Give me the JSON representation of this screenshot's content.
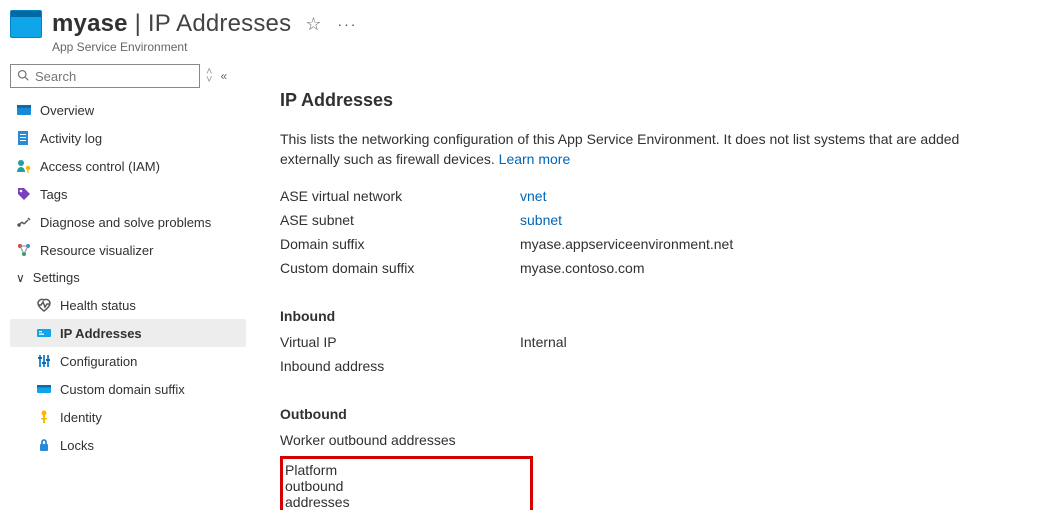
{
  "header": {
    "resource_name": "myase",
    "page_name": "IP Addresses",
    "resource_type": "App Service Environment",
    "star_tooltip": "Add to favorites",
    "more_tooltip": "More commands"
  },
  "sidebar": {
    "search_placeholder": "Search",
    "items": [
      {
        "label": "Overview"
      },
      {
        "label": "Activity log"
      },
      {
        "label": "Access control (IAM)"
      },
      {
        "label": "Tags"
      },
      {
        "label": "Diagnose and solve problems"
      },
      {
        "label": "Resource visualizer"
      }
    ],
    "settings_label": "Settings",
    "settings": [
      {
        "label": "Health status"
      },
      {
        "label": "IP Addresses"
      },
      {
        "label": "Configuration"
      },
      {
        "label": "Custom domain suffix"
      },
      {
        "label": "Identity"
      },
      {
        "label": "Locks"
      }
    ]
  },
  "main": {
    "title": "IP Addresses",
    "description": "This lists the networking configuration of this App Service Environment. It does not list systems that are added externally such as firewall devices.",
    "learn_more": "Learn more",
    "kv": {
      "ase_vnet_label": "ASE virtual network",
      "ase_vnet_value": "vnet",
      "ase_subnet_label": "ASE subnet",
      "ase_subnet_value": "subnet",
      "domain_suffix_label": "Domain suffix",
      "domain_suffix_value": "myase.appserviceenvironment.net",
      "custom_domain_suffix_label": "Custom domain suffix",
      "custom_domain_suffix_value": "myase.contoso.com"
    },
    "inbound": {
      "title": "Inbound",
      "vip_label": "Virtual IP",
      "vip_value": "Internal",
      "inbound_addr_label": "Inbound address"
    },
    "outbound": {
      "title": "Outbound",
      "worker_label": "Worker outbound addresses",
      "platform_label": "Platform outbound addresses"
    }
  }
}
